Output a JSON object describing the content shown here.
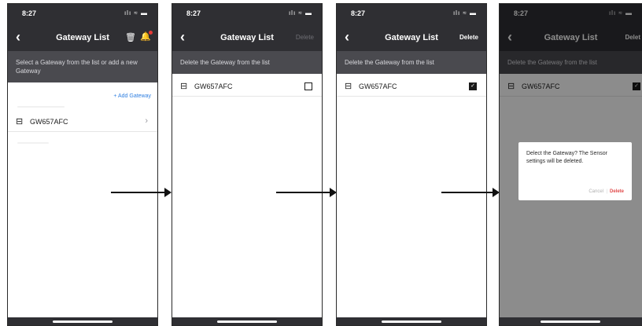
{
  "status_bar": {
    "time": "8:27",
    "icons": "ılı ≈ ▬"
  },
  "screen1": {
    "title": "Gateway List",
    "instruction": "Select a Gateway from the list or add a new Gateway",
    "add_gateway": "+ Add Gateway",
    "gateway": {
      "name": "GW657AFC"
    }
  },
  "screen2": {
    "title": "Gateway List",
    "delete_label": "Delete",
    "instruction": "Delete the Gateway from the list",
    "gateway": {
      "name": "GW657AFC",
      "checked": false
    }
  },
  "screen3": {
    "title": "Gateway List",
    "delete_label": "Delete",
    "instruction": "Delete the Gateway from the list",
    "gateway": {
      "name": "GW657AFC",
      "checked": true
    }
  },
  "screen4": {
    "title": "Gateway List",
    "delete_label": "Delet",
    "instruction": "Delete the Gateway from the list",
    "gateway": {
      "name": "GW657AFC",
      "checked": true
    },
    "dialog": {
      "message": "Delect the Gateway? The Sensor settings will be deleted.",
      "cancel": "Cancel",
      "delete": "Delete"
    }
  },
  "icons": {
    "back": "back-chevron-icon",
    "trash": "trash-icon",
    "bell": "notification-bell-icon",
    "gateway": "gateway-router-icon",
    "chevron": "chevron-right-icon",
    "check": "checkbox-icon"
  },
  "colors": {
    "header": "#2f2f33",
    "instruction": "#4a4a4f",
    "accent": "#2f7fe0",
    "danger": "#e14b4b"
  }
}
